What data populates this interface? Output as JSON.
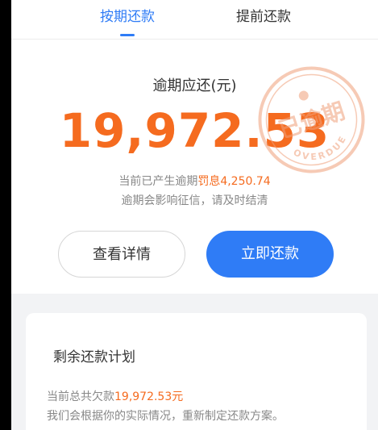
{
  "tabs": {
    "active_label": "按期还款",
    "inactive_label": "提前还款"
  },
  "overdue": {
    "label": "逾期应还(元)",
    "amount": "19,972.53",
    "penalty_prefix": "当前已产生逾期",
    "penalty_label": "罚息",
    "penalty_amount": "4,250.74",
    "notice": "逾期会影响征信，请及时结清",
    "stamp_text": "已逾期",
    "stamp_subtext": "OVERDUE"
  },
  "actions": {
    "details_label": "查看详情",
    "pay_label": "立即还款"
  },
  "plan": {
    "title": "剩余还款计划",
    "total_prefix": "当前总共欠款",
    "total_amount": "19,972.53元",
    "description": "我们会根据你的实际情况，重新制定还款方案。"
  },
  "colors": {
    "accent": "#2f7cf6",
    "amount": "#f56b1f",
    "stamp": "#f0a07a"
  }
}
